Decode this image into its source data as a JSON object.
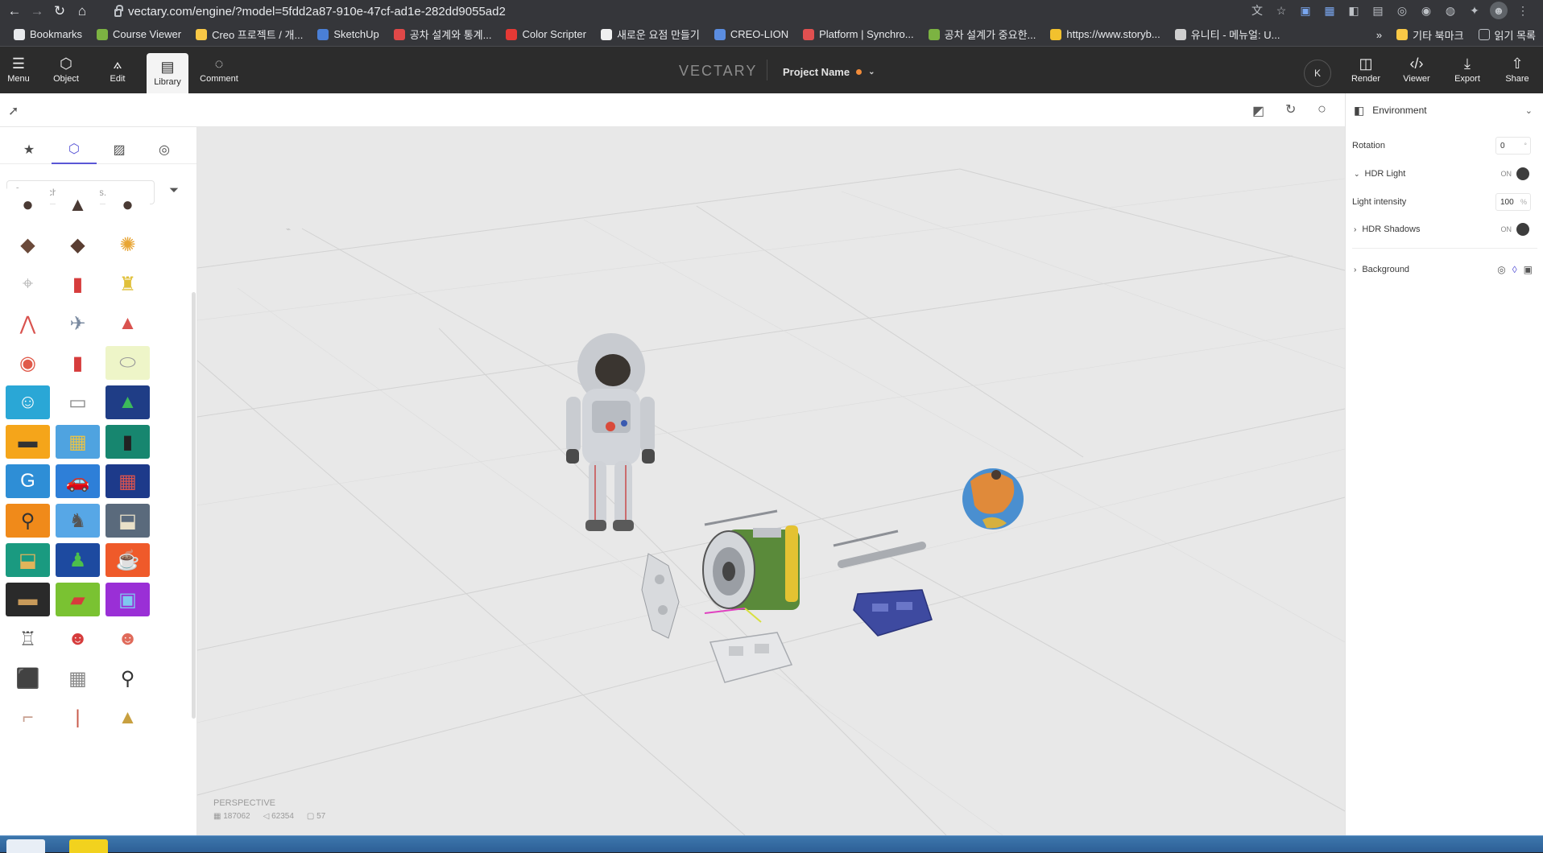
{
  "browser": {
    "url": "vectary.com/engine/?model=5fdd2a87-910e-47cf-ad1e-282dd9055ad2",
    "bookmarks": [
      {
        "label": "Bookmarks",
        "color": "#e8eaed"
      },
      {
        "label": "Course Viewer",
        "color": "#7cb342"
      },
      {
        "label": "Creo 프로젝트 / 개...",
        "color": "#f9c846"
      },
      {
        "label": "SketchUp",
        "color": "#4a7fd6"
      },
      {
        "label": "공차 설계와 통계...",
        "color": "#e04848"
      },
      {
        "label": "Color Scripter",
        "color": "#e53935"
      },
      {
        "label": "새로운 요점 만들기",
        "color": "#f0f0f0"
      },
      {
        "label": "CREO-LION",
        "color": "#5b8de0"
      },
      {
        "label": "Platform | Synchro...",
        "color": "#e05050"
      },
      {
        "label": "공차 설계가 중요한...",
        "color": "#7cb342"
      },
      {
        "label": "https://www.storyb...",
        "color": "#f2c12e"
      },
      {
        "label": "유니티 - 메뉴얼: U...",
        "color": "#cfcfcf"
      }
    ],
    "bookmarks_right": {
      "more": "»",
      "other_bookmarks": "기타 북마크",
      "reading_list": "읽기 목록"
    }
  },
  "header": {
    "buttons": [
      {
        "label": "Menu",
        "icon": "hamburger-icon"
      },
      {
        "label": "Object",
        "icon": "cube-icon"
      },
      {
        "label": "Edit",
        "icon": "edit-icon"
      },
      {
        "label": "Library",
        "icon": "library-icon"
      },
      {
        "label": "Comment",
        "icon": "comment-icon"
      }
    ],
    "brand": "VECTARY",
    "project_name": "Project Name",
    "avatar_initial": "K",
    "right_buttons": [
      {
        "label": "Render",
        "icon": "render-icon"
      },
      {
        "label": "Viewer",
        "icon": "code-icon"
      },
      {
        "label": "Export",
        "icon": "download-icon"
      },
      {
        "label": "Share",
        "icon": "share-icon"
      }
    ]
  },
  "library": {
    "search_placeholder": "Search 3D Assets...",
    "tabs": [
      "favorites-icon",
      "models-icon",
      "materials-icon",
      "environments-icon"
    ],
    "active_tab": 1,
    "thumbs": [
      {
        "icon": "●",
        "bg": "#ffffff",
        "fg": "#4a3a34"
      },
      {
        "icon": "▲",
        "bg": "#ffffff",
        "fg": "#4a3a34"
      },
      {
        "icon": "●",
        "bg": "#ffffff",
        "fg": "#4a3a34"
      },
      {
        "icon": "◆",
        "bg": "#ffffff",
        "fg": "#6b4a3a"
      },
      {
        "icon": "◆",
        "bg": "#ffffff",
        "fg": "#5a3e32"
      },
      {
        "icon": "✺",
        "bg": "#ffffff",
        "fg": "#e8a534"
      },
      {
        "icon": "⌖",
        "bg": "#ffffff",
        "fg": "#b9b9b9"
      },
      {
        "icon": "▮",
        "bg": "#ffffff",
        "fg": "#d63c3c"
      },
      {
        "icon": "♜",
        "bg": "#ffffff",
        "fg": "#e0c03a"
      },
      {
        "icon": "⋀",
        "bg": "#ffffff",
        "fg": "#d9534f"
      },
      {
        "icon": "✈",
        "bg": "#ffffff",
        "fg": "#7a8aa0"
      },
      {
        "icon": "▲",
        "bg": "#ffffff",
        "fg": "#d9534f"
      },
      {
        "icon": "◉",
        "bg": "#ffffff",
        "fg": "#e05a4a"
      },
      {
        "icon": "▮",
        "bg": "#ffffff",
        "fg": "#d63c3c"
      },
      {
        "icon": "⬭",
        "bg": "#eef5c8",
        "fg": "#9a9a9a"
      },
      {
        "icon": "☺",
        "bg": "#2aa7d6",
        "fg": "#ffffff"
      },
      {
        "icon": "▭",
        "bg": "#ffffff",
        "fg": "#8a8a8a"
      },
      {
        "icon": "▲",
        "bg": "#1f3d86",
        "fg": "#3cba5a"
      },
      {
        "icon": "▬",
        "bg": "#f5a51a",
        "fg": "#333333"
      },
      {
        "icon": "▦",
        "bg": "#4fa3e0",
        "fg": "#e6c24a"
      },
      {
        "icon": "▮",
        "bg": "#17866f",
        "fg": "#222222"
      },
      {
        "icon": "G",
        "bg": "#2e8ed6",
        "fg": "#ffffff"
      },
      {
        "icon": "🚗",
        "bg": "#2e7fd8",
        "fg": "#f2b632"
      },
      {
        "icon": "▦",
        "bg": "#1d3a8a",
        "fg": "#d9534f"
      },
      {
        "icon": "⚲",
        "bg": "#f08a1a",
        "fg": "#333333"
      },
      {
        "icon": "♞",
        "bg": "#57a7e6",
        "fg": "#555555"
      },
      {
        "icon": "⬓",
        "bg": "#5a6a7c",
        "fg": "#e8e0c8"
      },
      {
        "icon": "⬓",
        "bg": "#1a9a80",
        "fg": "#e0b45a"
      },
      {
        "icon": "♟",
        "bg": "#1d4aa0",
        "fg": "#4cbf4c"
      },
      {
        "icon": "☕",
        "bg": "#ef5a2a",
        "fg": "#ffffff"
      },
      {
        "icon": "▬",
        "bg": "#2a2a2a",
        "fg": "#c89a5a"
      },
      {
        "icon": "▰",
        "bg": "#7ac232",
        "fg": "#d63c3c"
      },
      {
        "icon": "▣",
        "bg": "#9a2fd6",
        "fg": "#7fc8f0"
      },
      {
        "icon": "♖",
        "bg": "#ffffff",
        "fg": "#555555"
      },
      {
        "icon": "☻",
        "bg": "#ffffff",
        "fg": "#d63c3c"
      },
      {
        "icon": "☻",
        "bg": "#ffffff",
        "fg": "#e06a5a"
      },
      {
        "icon": "⬛",
        "bg": "#ffffff",
        "fg": "#d63c3c"
      },
      {
        "icon": "▦",
        "bg": "#ffffff",
        "fg": "#888888"
      },
      {
        "icon": "⚲",
        "bg": "#ffffff",
        "fg": "#333333"
      },
      {
        "icon": "⌐",
        "bg": "#ffffff",
        "fg": "#c8a090"
      },
      {
        "icon": "|",
        "bg": "#ffffff",
        "fg": "#c85a4a"
      },
      {
        "icon": "▲",
        "bg": "#ffffff",
        "fg": "#c8a040"
      }
    ]
  },
  "viewport": {
    "mode_label": "PERSPECTIVE",
    "stats": {
      "vertices": "187062",
      "faces": "62354",
      "objects": "57"
    }
  },
  "environment": {
    "title": "Environment",
    "rotation_label": "Rotation",
    "rotation_value": "0",
    "rotation_unit": "°",
    "hdr_light_label": "HDR Light",
    "hdr_light_state": "ON",
    "light_intensity_label": "Light intensity",
    "light_intensity_value": "100",
    "light_intensity_unit": "%",
    "hdr_shadows_label": "HDR Shadows",
    "hdr_shadows_state": "ON",
    "background_label": "Background"
  }
}
